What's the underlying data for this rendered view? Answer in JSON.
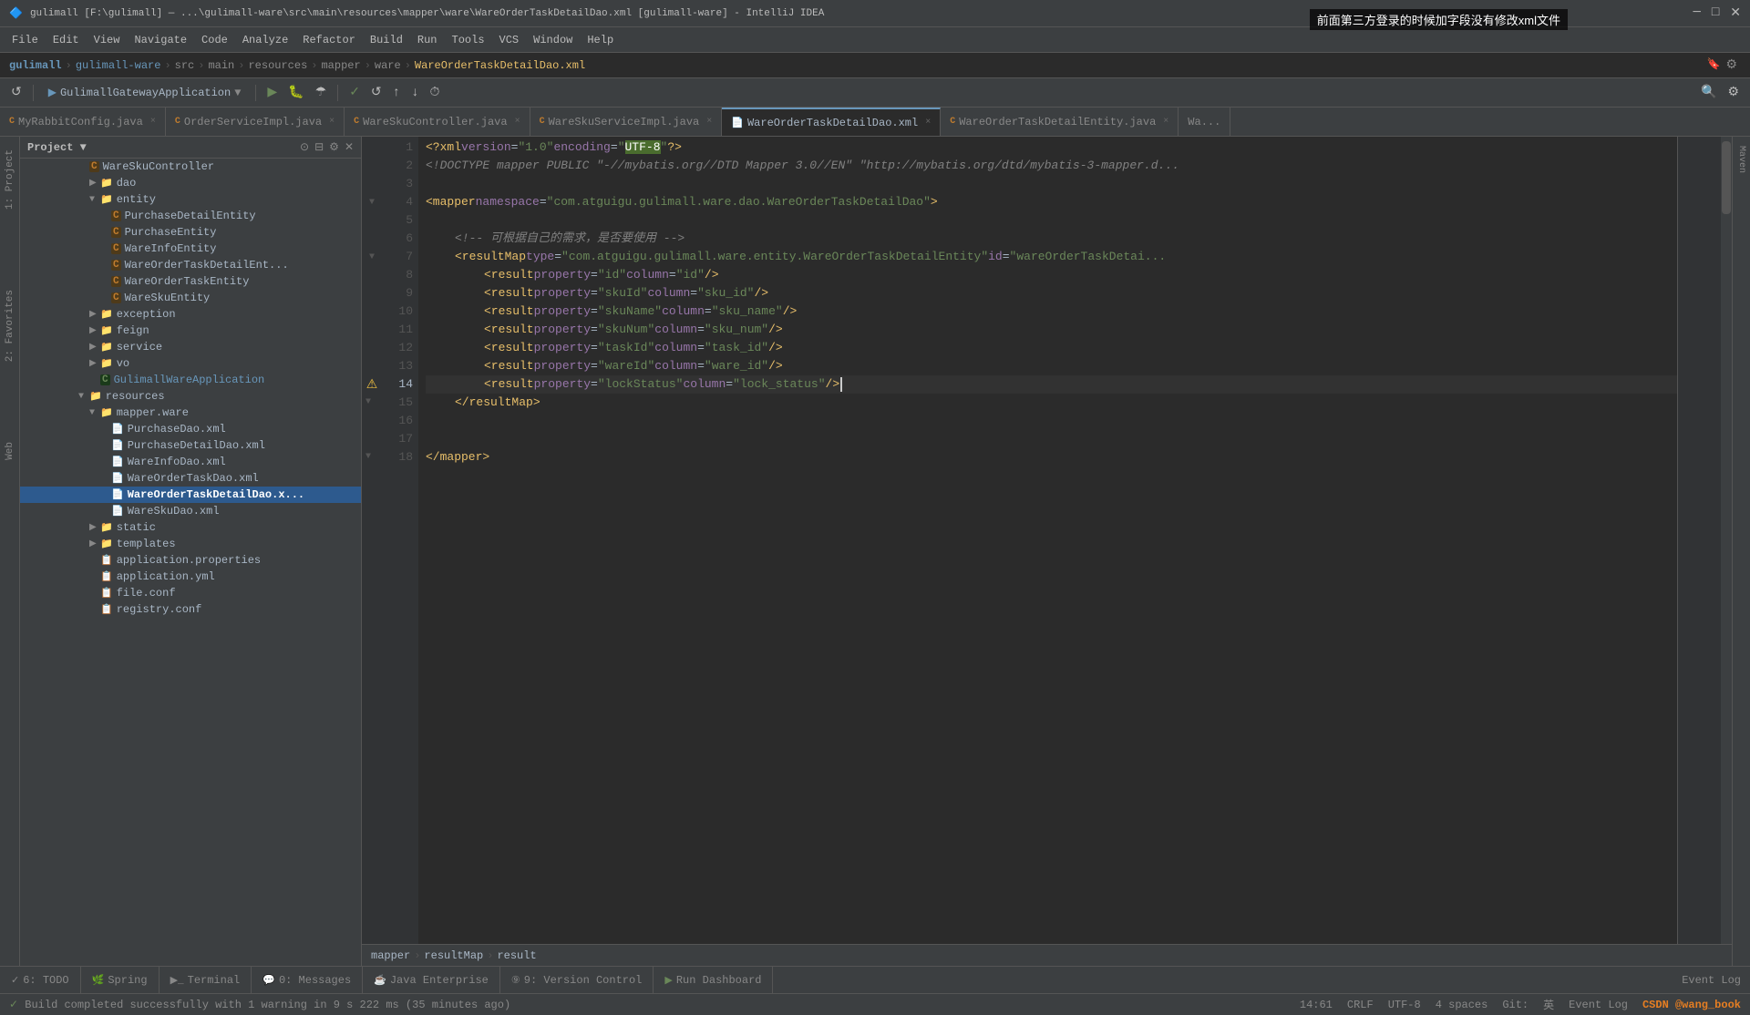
{
  "window": {
    "title": "gulimall [F:\\gulimall] — ...\\gulimall-ware\\src\\main\\resources\\mapper\\ware\\WareOrderTaskDetailDao.xml [gulimall-ware] - IntelliJ IDEA",
    "popup_title": "前面第三方登录的时候加字段没有修改xml文件"
  },
  "menu": {
    "items": [
      "File",
      "Edit",
      "View",
      "Navigate",
      "Code",
      "Analyze",
      "Refactor",
      "Build",
      "Run",
      "Tools",
      "VCS",
      "Window",
      "Help"
    ]
  },
  "breadcrumb_top": {
    "items": [
      "gulimall",
      "gulimall-ware",
      "src",
      "main",
      "resources",
      "mapper",
      "ware",
      "WareOrderTaskDetailDao.xml"
    ]
  },
  "tabs": [
    {
      "label": "MyRabbitConfig.java",
      "active": false,
      "closable": true
    },
    {
      "label": "OrderServiceImpl.java",
      "active": false,
      "closable": true
    },
    {
      "label": "WareSkuController.java",
      "active": false,
      "closable": true
    },
    {
      "label": "WareSkuServiceImpl.java",
      "active": false,
      "closable": true
    },
    {
      "label": "WareOrderTaskDetailDao.xml",
      "active": true,
      "closable": true
    },
    {
      "label": "WareOrderTaskDetailEntity.java",
      "active": false,
      "closable": true
    },
    {
      "label": "Wa...",
      "active": false,
      "closable": false
    }
  ],
  "sidebar": {
    "title": "Project",
    "tree": [
      {
        "indent": 60,
        "type": "class",
        "icon": "C",
        "label": "WareSkuController",
        "depth": 3
      },
      {
        "indent": 72,
        "type": "folder",
        "icon": "folder",
        "label": "dao",
        "depth": 4,
        "expanded": false
      },
      {
        "indent": 72,
        "type": "folder",
        "icon": "folder",
        "label": "entity",
        "depth": 4,
        "expanded": true
      },
      {
        "indent": 84,
        "type": "class",
        "icon": "C",
        "label": "PurchaseDetailEntity",
        "depth": 5
      },
      {
        "indent": 84,
        "type": "class",
        "icon": "C",
        "label": "PurchaseEntity",
        "depth": 5
      },
      {
        "indent": 84,
        "type": "class",
        "icon": "C",
        "label": "WareInfoEntity",
        "depth": 5
      },
      {
        "indent": 84,
        "type": "class",
        "icon": "C",
        "label": "WareOrderTaskDetailEnt...",
        "depth": 5
      },
      {
        "indent": 84,
        "type": "class",
        "icon": "C",
        "label": "WareOrderTaskEntity",
        "depth": 5
      },
      {
        "indent": 84,
        "type": "class",
        "icon": "C",
        "label": "WareSkuEntity",
        "depth": 5
      },
      {
        "indent": 72,
        "type": "folder",
        "icon": "folder",
        "label": "exception",
        "depth": 4,
        "expanded": false
      },
      {
        "indent": 72,
        "type": "folder",
        "icon": "folder",
        "label": "feign",
        "depth": 4,
        "expanded": false
      },
      {
        "indent": 72,
        "type": "folder",
        "icon": "folder",
        "label": "service",
        "depth": 4,
        "expanded": false
      },
      {
        "indent": 72,
        "type": "folder",
        "icon": "folder",
        "label": "vo",
        "depth": 4,
        "expanded": false
      },
      {
        "indent": 72,
        "type": "app-class",
        "icon": "C-green",
        "label": "GulimallWareApplication",
        "depth": 4
      },
      {
        "indent": 60,
        "type": "folder",
        "icon": "folder",
        "label": "resources",
        "depth": 3,
        "expanded": true
      },
      {
        "indent": 72,
        "type": "folder",
        "icon": "folder",
        "label": "mapper.ware",
        "depth": 4,
        "expanded": true
      },
      {
        "indent": 84,
        "type": "xml",
        "icon": "xml",
        "label": "PurchaseDao.xml",
        "depth": 5
      },
      {
        "indent": 84,
        "type": "xml",
        "icon": "xml",
        "label": "PurchaseDetailDao.xml",
        "depth": 5
      },
      {
        "indent": 84,
        "type": "xml",
        "icon": "xml",
        "label": "WareInfoDao.xml",
        "depth": 5
      },
      {
        "indent": 84,
        "type": "xml",
        "icon": "xml",
        "label": "WareOrderTaskDao.xml",
        "depth": 5
      },
      {
        "indent": 84,
        "type": "xml-selected",
        "icon": "xml",
        "label": "WareOrderTaskDetailDao.x...",
        "depth": 5,
        "selected": true
      },
      {
        "indent": 84,
        "type": "xml",
        "icon": "xml",
        "label": "WareSkuDao.xml",
        "depth": 5
      },
      {
        "indent": 72,
        "type": "folder",
        "icon": "folder",
        "label": "static",
        "depth": 4,
        "expanded": false
      },
      {
        "indent": 72,
        "type": "folder",
        "icon": "folder",
        "label": "templates",
        "depth": 4,
        "expanded": false
      },
      {
        "indent": 72,
        "type": "properties",
        "icon": "properties",
        "label": "application.properties",
        "depth": 4
      },
      {
        "indent": 72,
        "type": "properties",
        "icon": "properties",
        "label": "application.yml",
        "depth": 4
      },
      {
        "indent": 72,
        "type": "properties",
        "icon": "properties",
        "label": "file.conf",
        "depth": 4
      },
      {
        "indent": 72,
        "type": "properties",
        "icon": "properties",
        "label": "registry.conf",
        "depth": 4
      }
    ]
  },
  "code_lines": [
    {
      "num": 1,
      "content": "<?xml version=\"1.0\" encoding=\"UTF-8\"?>",
      "highlight_word": "UTF-8"
    },
    {
      "num": 2,
      "content": "<!DOCTYPE mapper PUBLIC \"-//mybatis.org//DTD Mapper 3.0//EN\" \"http://mybatis.org/dtd/mybatis-3-mapper.d..."
    },
    {
      "num": 3,
      "content": ""
    },
    {
      "num": 4,
      "content": "<mapper namespace=\"com.atguigu.gulimall.ware.dao.WareOrderTaskDetailDao\">"
    },
    {
      "num": 5,
      "content": ""
    },
    {
      "num": 6,
      "content": "    <!-- 可根据自己的需求，是否要使用 -->"
    },
    {
      "num": 7,
      "content": "    <resultMap type=\"com.atguigu.gulimall.ware.entity.WareOrderTaskDetailEntity\" id=\"wareOrderTaskDetai..."
    },
    {
      "num": 8,
      "content": "        <result property=\"id\" column=\"id\"/>"
    },
    {
      "num": 9,
      "content": "        <result property=\"skuId\" column=\"sku_id\"/>"
    },
    {
      "num": 10,
      "content": "        <result property=\"skuName\" column=\"sku_name\"/>"
    },
    {
      "num": 11,
      "content": "        <result property=\"skuNum\" column=\"sku_num\"/>"
    },
    {
      "num": 12,
      "content": "        <result property=\"taskId\" column=\"task_id\"/>"
    },
    {
      "num": 13,
      "content": "        <result property=\"wareId\" column=\"ware_id\"/>"
    },
    {
      "num": 14,
      "content": "        <result property=\"lockStatus\" column=\"lock_status\"/>",
      "is_current": true,
      "has_warning": true
    },
    {
      "num": 15,
      "content": "    </resultMap>"
    },
    {
      "num": 16,
      "content": ""
    },
    {
      "num": 17,
      "content": ""
    },
    {
      "num": 18,
      "content": "</mapper>"
    }
  ],
  "editor_breadcrumb": {
    "items": [
      "mapper",
      "resultMap",
      "result"
    ]
  },
  "bottom_tabs": [
    {
      "label": "6: TODO",
      "icon": "todo",
      "active": false
    },
    {
      "label": "Spring",
      "icon": "spring",
      "active": false
    },
    {
      "label": "Terminal",
      "icon": "terminal",
      "active": false
    },
    {
      "label": "0: Messages",
      "icon": "messages",
      "active": false
    },
    {
      "label": "Java Enterprise",
      "icon": "java",
      "active": false
    },
    {
      "label": "9: Version Control",
      "icon": "vc",
      "active": false
    },
    {
      "label": "Run Dashboard",
      "icon": "run",
      "active": false
    }
  ],
  "status_bar": {
    "build_message": "Build completed successfully with 1 warning in 9 s 222 ms (35 minutes ago)",
    "position": "14:61",
    "line_sep": "CRLF",
    "encoding": "UTF-8",
    "indent": "4 spaces",
    "right_items": [
      "英",
      "Event Log"
    ]
  },
  "toolbar": {
    "run_config": "GulimallGatewayApplication"
  }
}
